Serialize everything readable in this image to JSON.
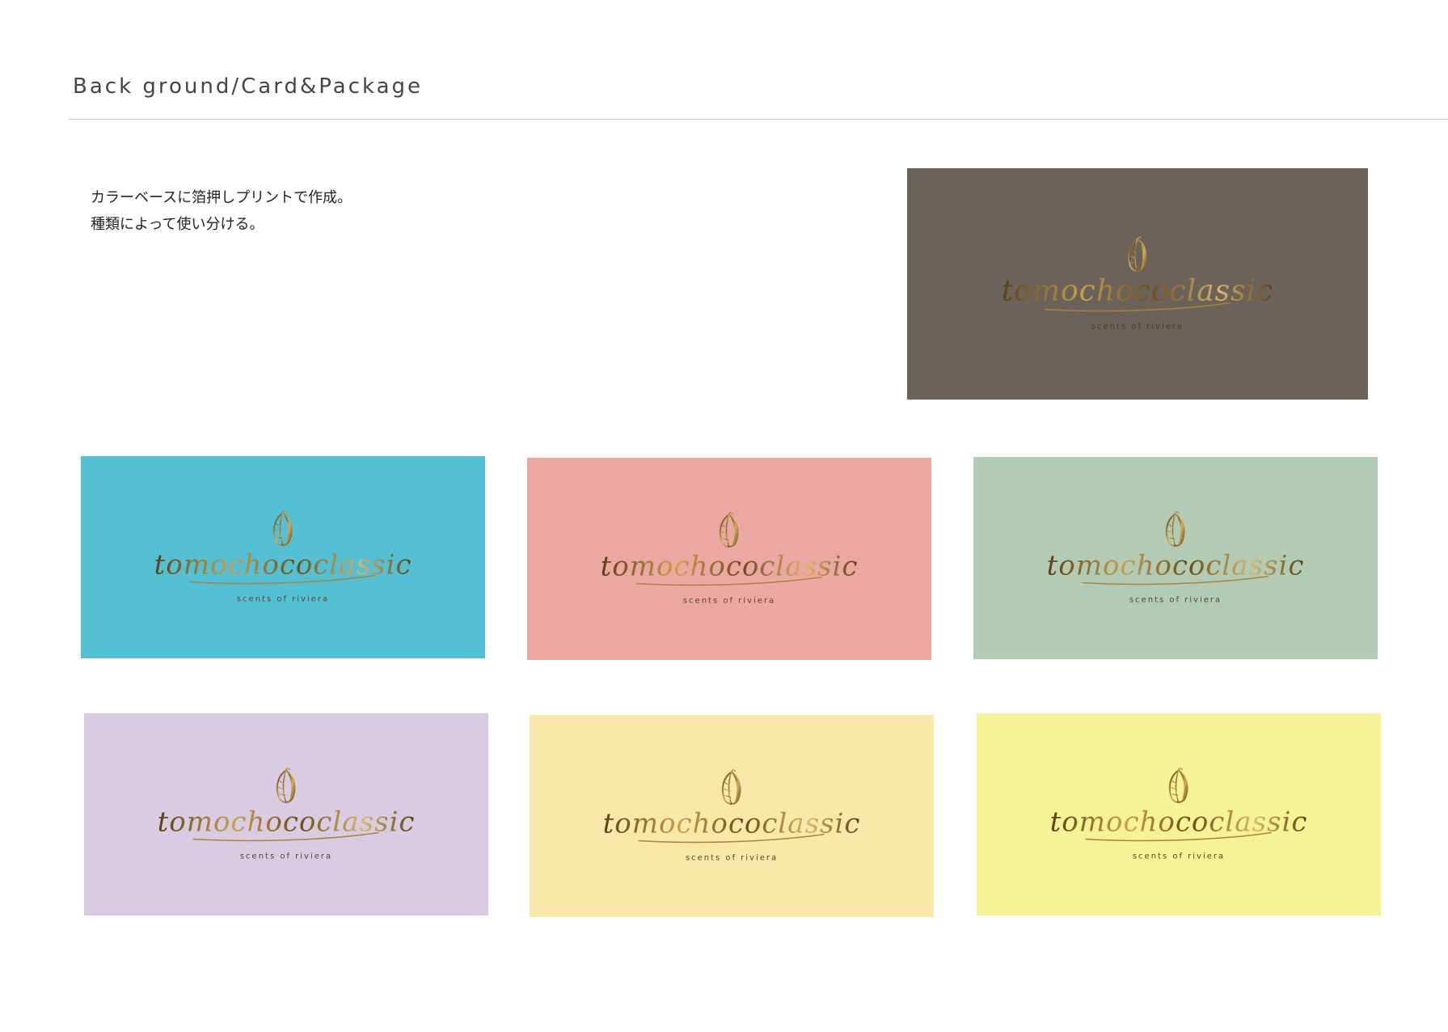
{
  "page": {
    "title": "Back ground/Card&Package",
    "description_lines": [
      "カラーベースに箔押しプリントで作成。",
      "種類によって使い分ける。"
    ]
  },
  "brand": {
    "wordmark": "tomochococlassic",
    "tagline": "scents of riviera",
    "icon": "cacao-pod-icon",
    "foil_color": "#b8903e"
  },
  "cards": [
    {
      "id": "taupe",
      "color": "#6b6259"
    },
    {
      "id": "turquoise",
      "color": "#54c0d4"
    },
    {
      "id": "pink",
      "color": "#eba7a2"
    },
    {
      "id": "sage",
      "color": "#b2cbb5"
    },
    {
      "id": "lavender",
      "color": "#d9cbe1"
    },
    {
      "id": "cream",
      "color": "#f8e8aa"
    },
    {
      "id": "lemon",
      "color": "#f6f296"
    }
  ]
}
